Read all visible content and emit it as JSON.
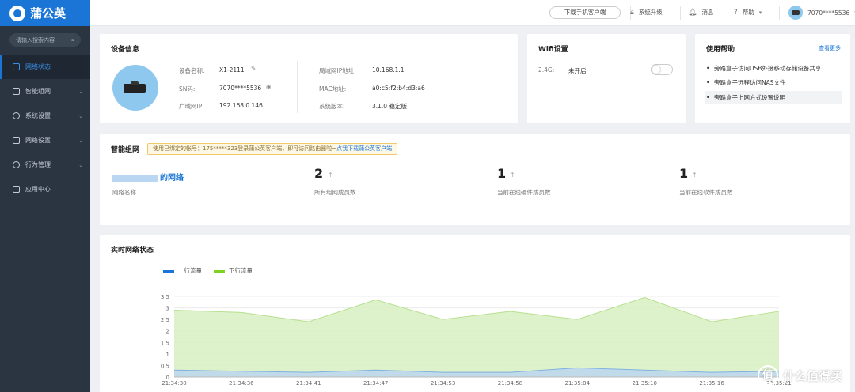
{
  "sidebar": {
    "logo": "蒲公英",
    "search_placeholder": "请输入搜索内容",
    "items": [
      {
        "label": "网络状态"
      },
      {
        "label": "智能组网"
      },
      {
        "label": "系统设置"
      },
      {
        "label": "网络设置"
      },
      {
        "label": "行为管理"
      },
      {
        "label": "应用中心"
      }
    ]
  },
  "topbar": {
    "download": "下载手机客户端",
    "upgrade": "系统升级",
    "messages": "消息",
    "help": "帮助",
    "user": "7070****5536"
  },
  "device": {
    "title": "设备信息",
    "name_label": "设备名称:",
    "name": "X1-2111",
    "sn_label": "SN码:",
    "sn": "7070****5536",
    "wan_label": "广域网IP:",
    "wan": "192.168.0.146",
    "lan_label": "局域网IP地址:",
    "lan": "10.168.1.1",
    "mac_label": "MAC地址:",
    "mac": "a0:c5:f2:b4:d3:a6",
    "ver_label": "系统版本:",
    "ver": "3.1.0 稳定版"
  },
  "wifi": {
    "title": "Wifi设置",
    "band": "2.4G:",
    "state": "未开启"
  },
  "help": {
    "title": "使用帮助",
    "more": "查看更多",
    "items": [
      "旁路盒子访问USB外接移动存储设备共享...",
      "旁路盒子远程访问NAS文件",
      "旁路盒子上网方式设置说明"
    ]
  },
  "smart": {
    "title": "智能组网",
    "tip": "使用已绑定的帐号：175*****323登录蒲公英客户端，即可访问路由器啦~",
    "tip_link": "点我下载蒲公英客户端",
    "net_suffix": "的网络",
    "net_label": "网络名称",
    "stats": [
      {
        "num": "2",
        "label": "所有组网成员数"
      },
      {
        "num": "1",
        "label": "当前在线硬件成员数"
      },
      {
        "num": "1",
        "label": "当前在线软件成员数"
      }
    ],
    "arrow": "↑"
  },
  "realtime": {
    "title": "实时网络状态"
  },
  "chart_data": {
    "type": "area",
    "title": "",
    "xlabel": "",
    "ylabel": "",
    "x": [
      "21:34:30",
      "21:34:36",
      "21:34:41",
      "21:34:47",
      "21:34:53",
      "21:34:58",
      "21:35:04",
      "21:35:10",
      "21:35:16",
      "21:35:21"
    ],
    "yticks": [
      "0",
      "0.5",
      "1",
      "1.5",
      "2",
      "2.5",
      "3",
      "3.5"
    ],
    "ylim": [
      0,
      3.5
    ],
    "series": [
      {
        "name": "上行流量",
        "color": "#1a75d6",
        "values": [
          0.3,
          0.25,
          0.2,
          0.3,
          0.2,
          0.2,
          0.4,
          0.3,
          0.2,
          0.25
        ]
      },
      {
        "name": "下行流量",
        "color": "#7ed321",
        "values": [
          2.9,
          2.8,
          2.4,
          3.35,
          2.5,
          2.85,
          2.5,
          3.45,
          2.4,
          2.85
        ]
      }
    ],
    "legend": "top-left"
  },
  "watermark": {
    "text": "什么值得买",
    "glyph": "值"
  }
}
